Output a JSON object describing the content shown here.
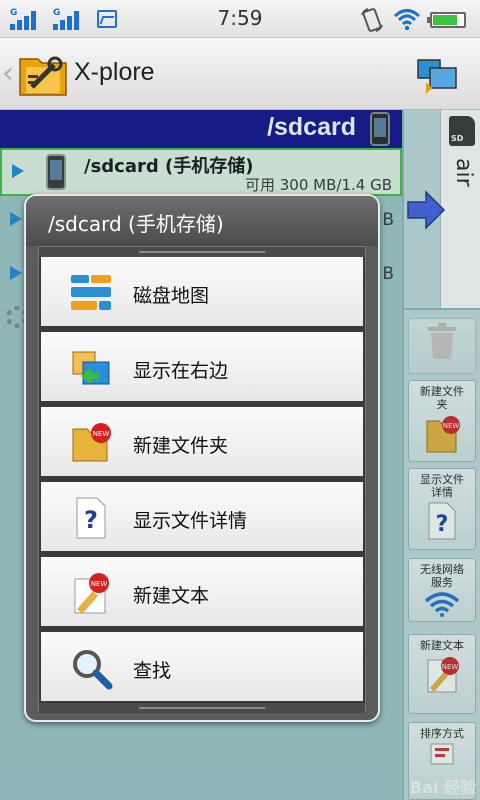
{
  "status_bar": {
    "time": "7:59",
    "signal_label": "G",
    "battery_level": 0.8,
    "colors": {
      "signal": "#1d6fd6",
      "battery": "#3fc33f"
    }
  },
  "titlebar": {
    "app_name": "X-plore"
  },
  "left_pane": {
    "path": "/sdcard",
    "selected_entry": {
      "name": "/sdcard (手机存储)",
      "free_space": "可用 300 MB/1.4 GB"
    },
    "hidden_rows": [
      {
        "tail": "B"
      },
      {
        "tail": "B"
      }
    ]
  },
  "right_pane": {
    "storage_label": "air",
    "sd_badge": "SD",
    "toolbar": [
      {
        "label": "",
        "icon": "trash-icon"
      },
      {
        "label": "新建文件夹",
        "icon": "new-folder-icon"
      },
      {
        "label": "显示文件详情",
        "icon": "file-details-icon"
      },
      {
        "label": "无线网络服务",
        "icon": "wifi-service-icon"
      },
      {
        "label": "新建文本",
        "icon": "new-text-icon"
      },
      {
        "label": "排序方式",
        "icon": "sort-icon"
      }
    ]
  },
  "dialog": {
    "title": "/sdcard (手机存储)",
    "items": [
      {
        "label": "磁盘地图",
        "icon": "disk-map-icon"
      },
      {
        "label": "显示在右边",
        "icon": "show-right-icon"
      },
      {
        "label": "新建文件夹",
        "icon": "new-folder-icon"
      },
      {
        "label": "显示文件详情",
        "icon": "file-details-icon"
      },
      {
        "label": "新建文本",
        "icon": "new-text-icon"
      },
      {
        "label": "查找",
        "icon": "search-icon"
      }
    ]
  },
  "watermark": "Bai 经验"
}
